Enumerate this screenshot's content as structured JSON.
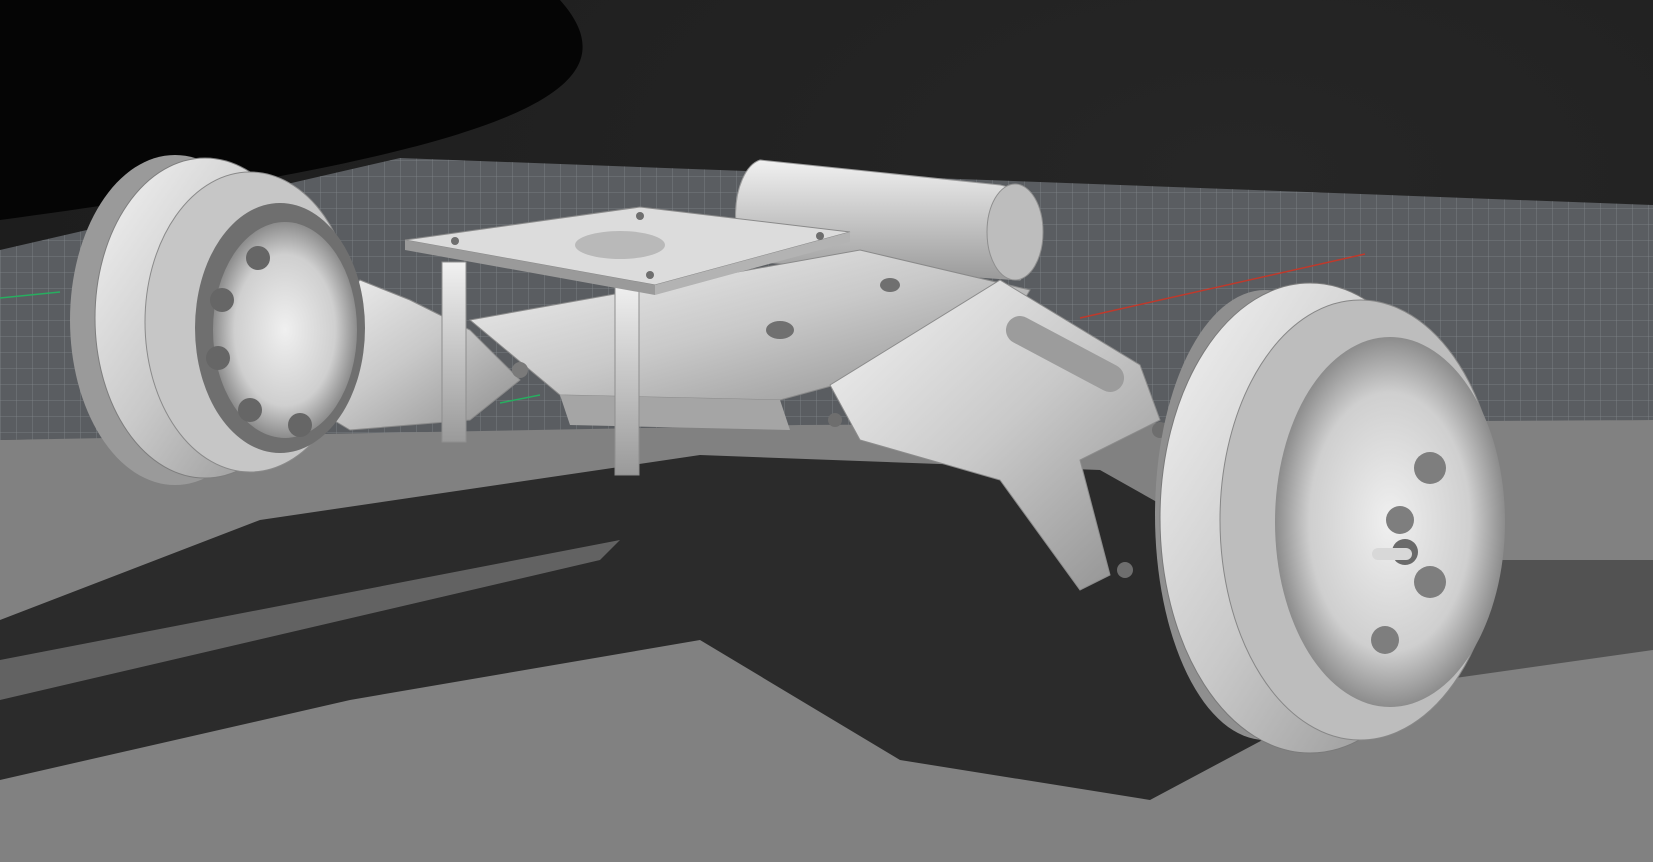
{
  "viewport": {
    "background_color": "#050505",
    "grid_plane_color": "#5c5f63",
    "grid_line_color": "#8a8e93",
    "floor_color": "#818181",
    "shadow_color": "#2a2a2a",
    "part_color": "#cfcfcf",
    "x_axis_color": "#c0392b",
    "y_axis_color": "#27ae60"
  },
  "scene": {
    "model": "rc-car-front-suspension-assembly",
    "components": [
      {
        "name": "left-wheel-icon"
      },
      {
        "name": "right-wheel-icon"
      },
      {
        "name": "servo-mount-plate-icon"
      },
      {
        "name": "chassis-beam-icon"
      },
      {
        "name": "lower-arm-icon"
      },
      {
        "name": "battery-housing-icon"
      }
    ]
  }
}
